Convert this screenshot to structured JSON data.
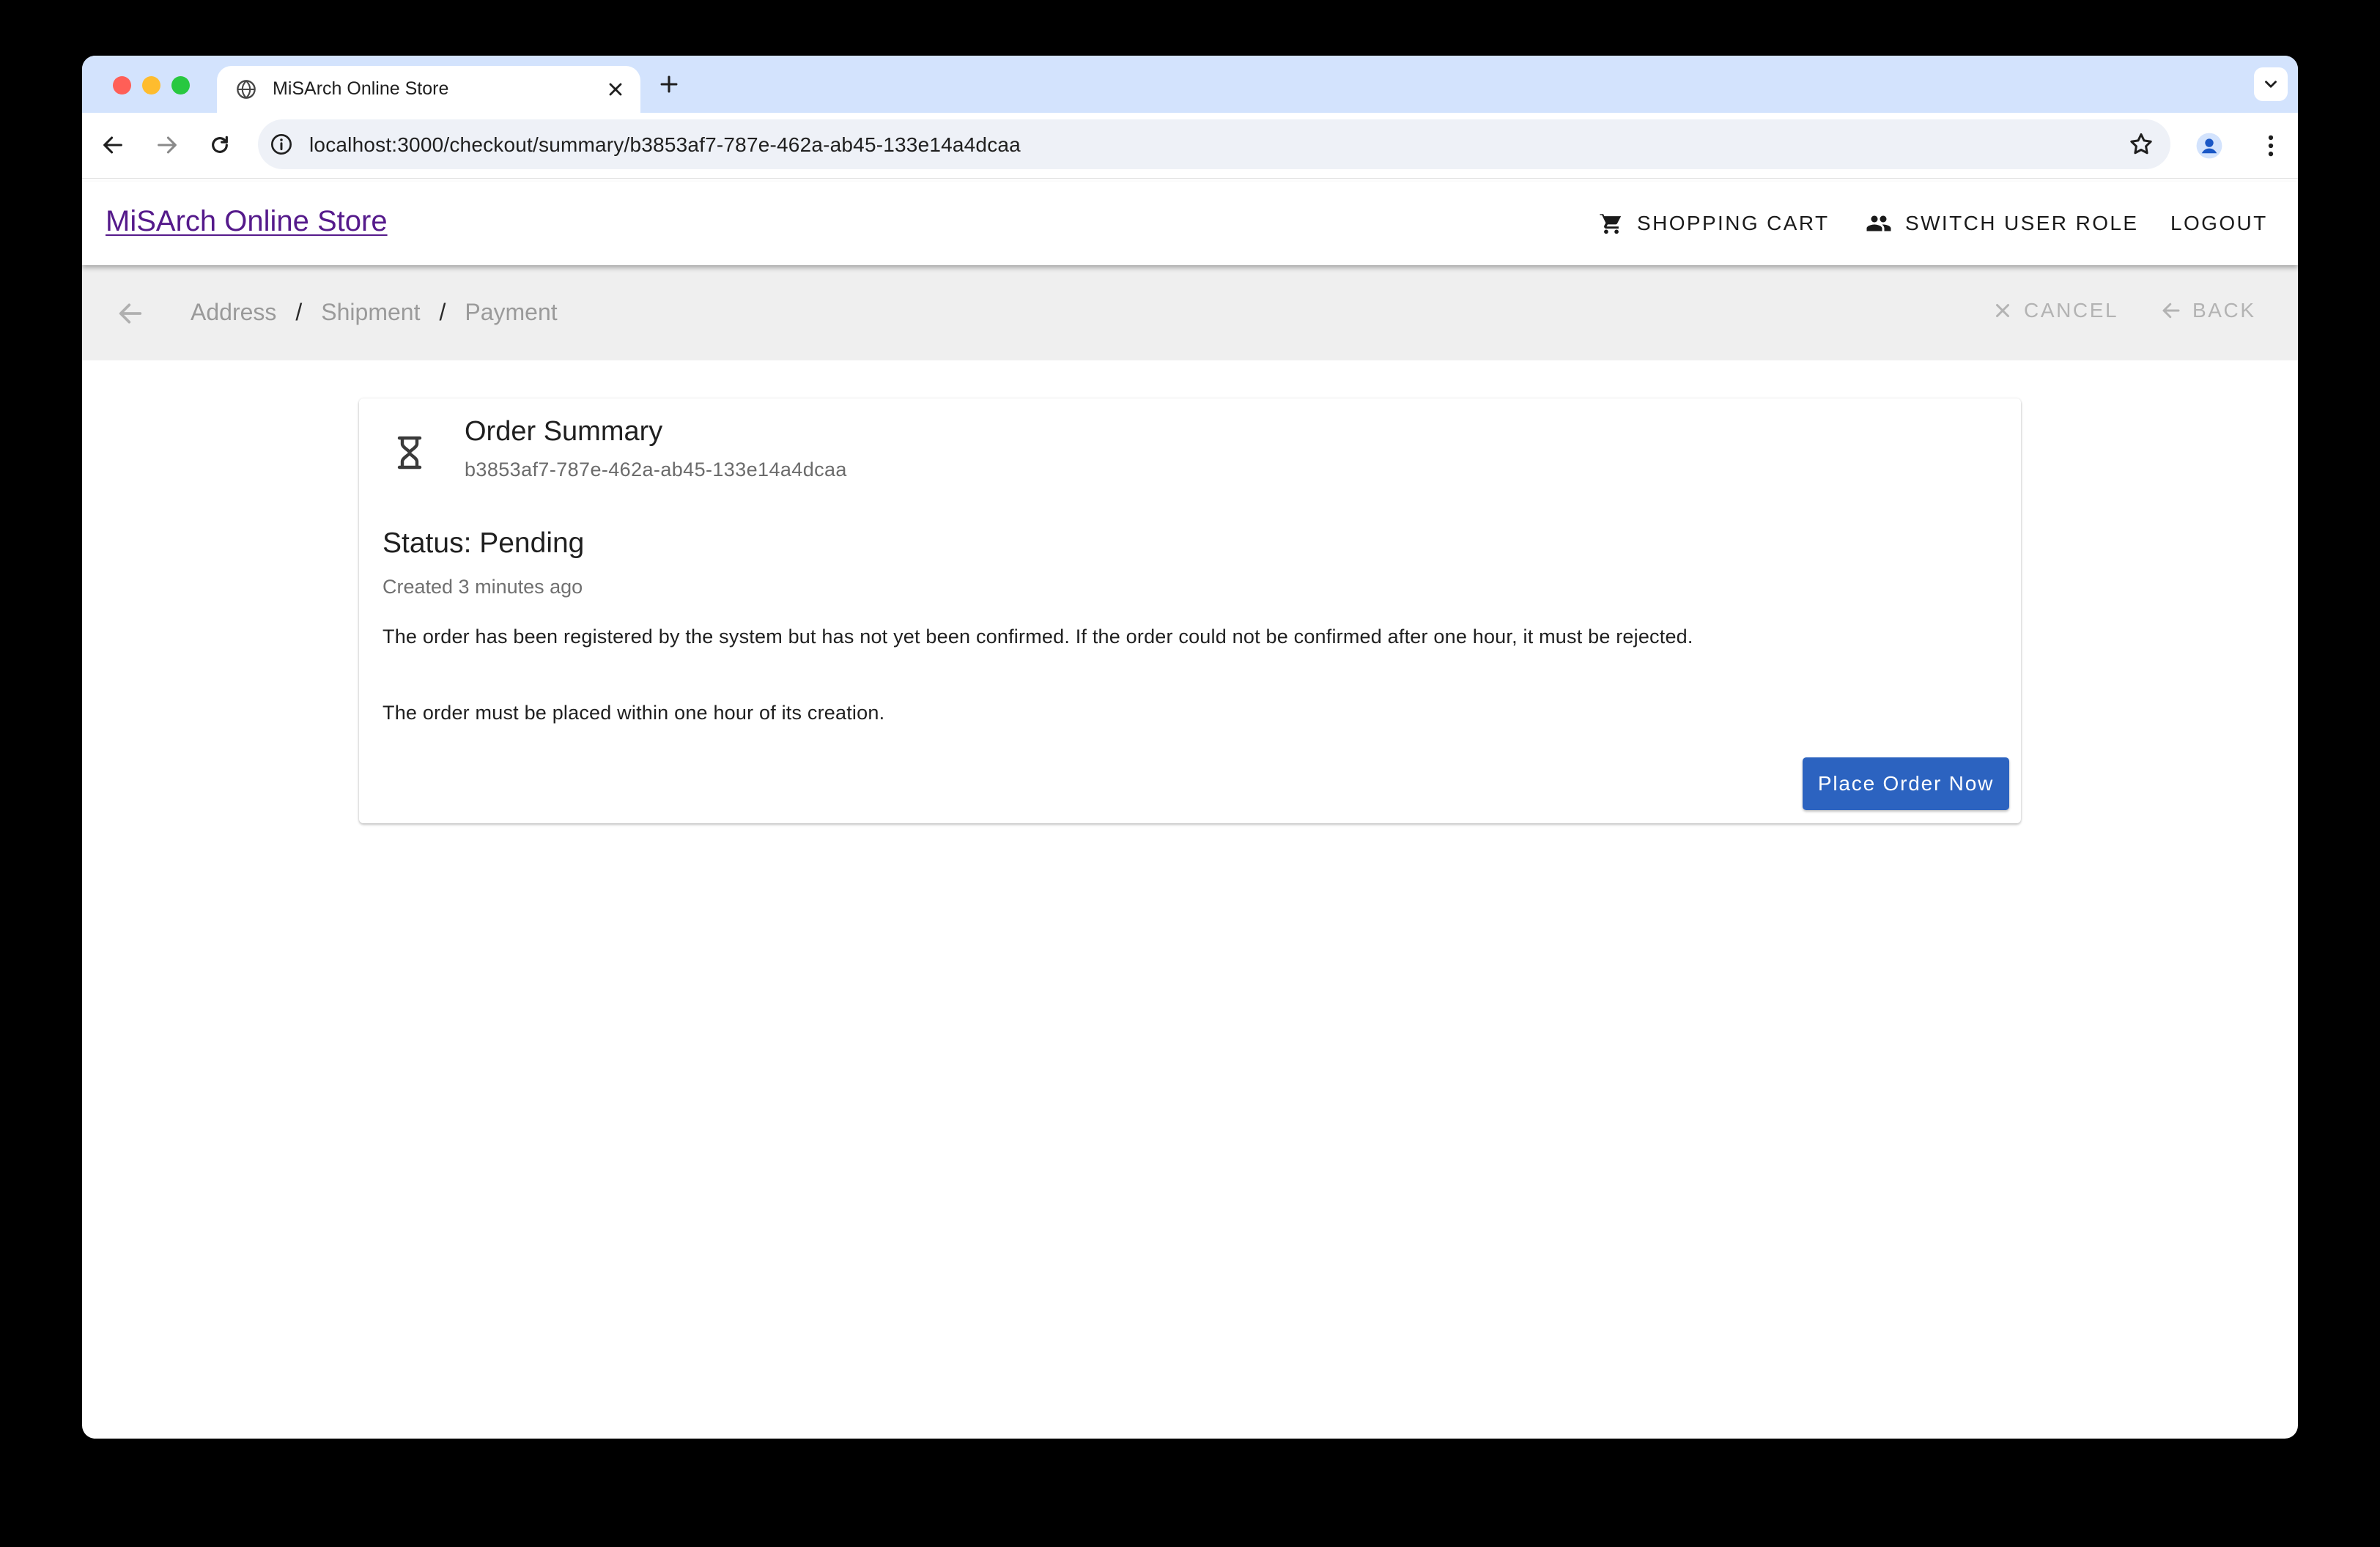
{
  "browser": {
    "tab_title": "MiSArch Online Store",
    "url": "localhost:3000/checkout/summary/b3853af7-787e-462a-ab45-133e14a4dcaa",
    "icons": [
      "globe-icon",
      "close-icon",
      "plus-icon",
      "chevron-down-icon",
      "back-arrow-icon",
      "forward-arrow-icon",
      "reload-icon",
      "info-icon",
      "star-icon",
      "profile-icon",
      "kebab-menu-icon"
    ]
  },
  "app": {
    "brand": "MiSArch Online Store",
    "shopping_cart": "SHOPPING CART",
    "switch_role": "SWITCH USER ROLE",
    "logout": "LOGOUT"
  },
  "checkout": {
    "crumbs": [
      "Address",
      "Shipment",
      "Payment"
    ],
    "separator": "/",
    "cancel": "CANCEL",
    "back": "BACK"
  },
  "summary": {
    "title": "Order Summary",
    "order_id": "b3853af7-787e-462a-ab45-133e14a4dcaa",
    "status": "Status: Pending",
    "created": "Created 3 minutes ago",
    "paragraph_1": "The order has been registered by the system but has not yet been confirmed. If the order could not be confirmed after one hour, it must be rejected.",
    "paragraph_2": "The order must be placed within one hour of its creation.",
    "place_order": "Place Order Now"
  },
  "colors": {
    "tabstrip": "#d3e3fd",
    "brand_link": "#551a8b",
    "primary_button": "#2c63c0",
    "checkout_bar": "#efefef"
  }
}
